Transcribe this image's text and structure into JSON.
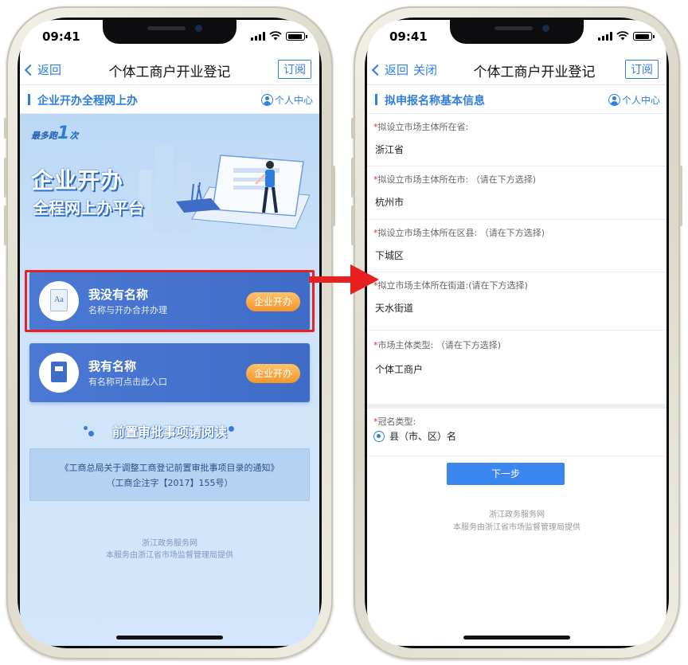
{
  "status_bar": {
    "time": "09:41"
  },
  "left_screen": {
    "nav": {
      "back": "返回",
      "title": "个体工商户开业登记",
      "subscribe": "订阅"
    },
    "section_title": "企业开办全程网上办",
    "personal_center": "个人中心",
    "banner": {
      "logo": "最多跑1次",
      "logo_pre": "最多跑",
      "logo_num": "1",
      "logo_post": "次",
      "title_line1": "企业开办",
      "title_line2": "全程网上办平台"
    },
    "cards": [
      {
        "name": "我没有名称",
        "desc": "名称与开办合并办理",
        "button": "企业开办",
        "icon_text": "Aa"
      },
      {
        "name": "我有名称",
        "desc": "有名称可点击此入口",
        "button": "企业开办"
      }
    ],
    "notice_title": "前置审批事项请阅读",
    "notice_line1": "《工商总局关于调整工商登记前置审批事项目录的通知》",
    "notice_line2": "（工商企注字【2017】155号）",
    "footer_line1": "浙江政务服务网",
    "footer_line2": "本服务由浙江省市场监督管理局提供"
  },
  "right_screen": {
    "nav": {
      "back": "返回",
      "close": "关闭",
      "title": "个体工商户开业登记",
      "subscribe": "订阅"
    },
    "section_title": "拟申报名称基本信息",
    "personal_center": "个人中心",
    "fields": [
      {
        "label": "拟设立市场主体所在省:",
        "value": "浙江省"
      },
      {
        "label": "拟设立市场主体所在市: （请在下方选择)",
        "value": "杭州市"
      },
      {
        "label": "拟设立市场主体所在区县: （请在下方选择)",
        "value": "下城区"
      },
      {
        "label": "拟立市场主体所在街道:(请在下方选择)",
        "value": "天水街道"
      },
      {
        "label": "市场主体类型: （请在下方选择)",
        "value": "个体工商户"
      }
    ],
    "crown_label": "冠名类型:",
    "crown_option": "县（市、区）名",
    "next_button": "下一步",
    "footer_line1": "浙江政务服务网",
    "footer_line2": "本服务由浙江省市场监督管理局提供"
  },
  "colors": {
    "accent": "#2f7de1",
    "highlight_red": "#e8201f",
    "card_blue": "#4a79d4",
    "pill_orange": "#f3952d"
  }
}
